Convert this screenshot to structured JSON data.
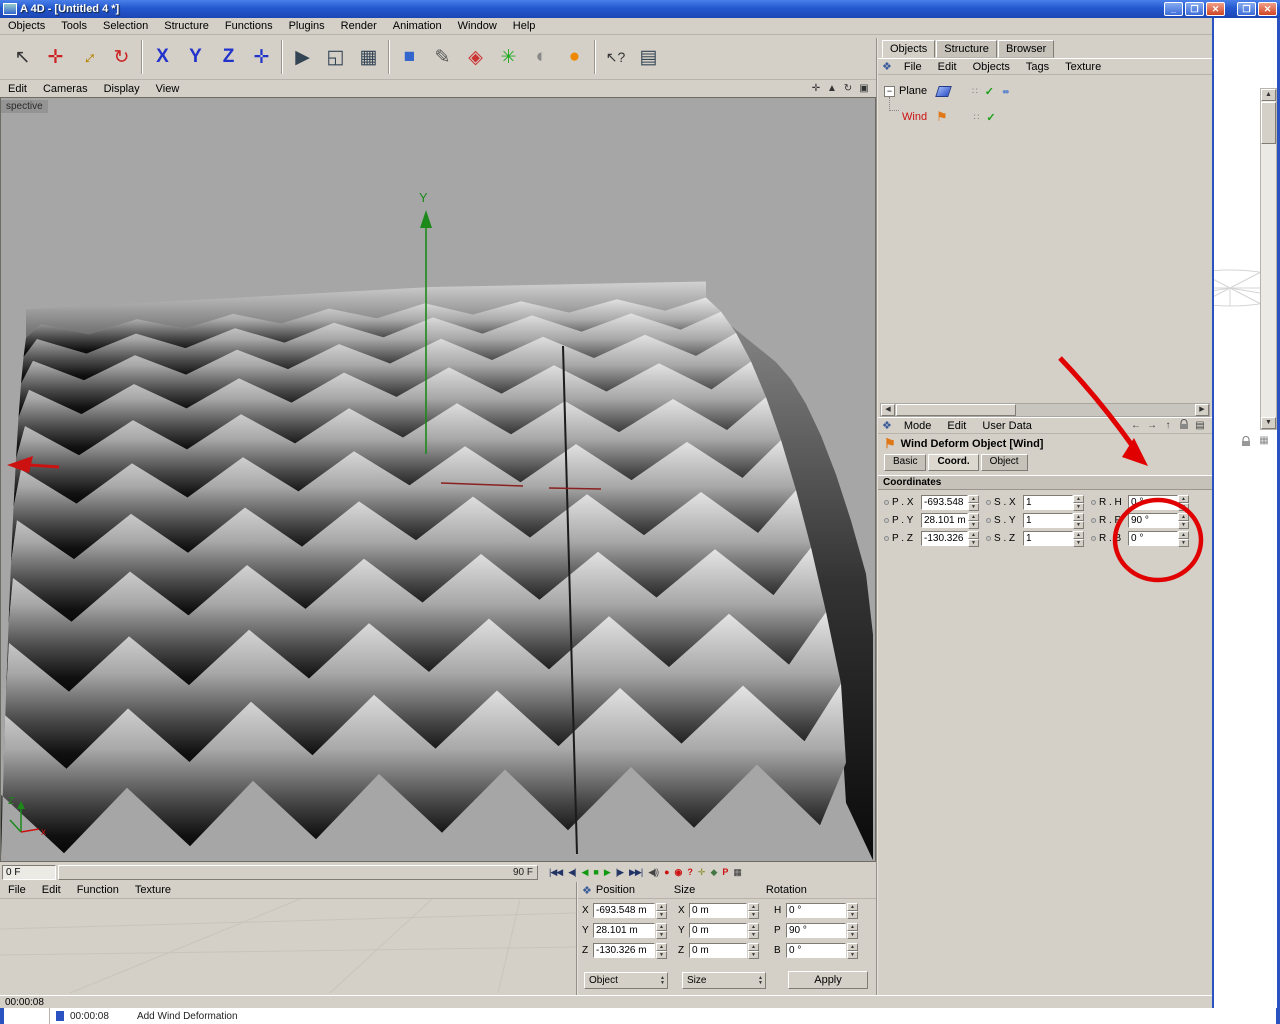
{
  "window": {
    "title": "A 4D - [Untitled 4 *]",
    "status_time": "00:00:08",
    "taskbar_time": "00:00:08",
    "taskbar_action": "Add Wind Deformation",
    "buttons": {
      "minimize": "_",
      "maximize": "❐",
      "close": "✕"
    }
  },
  "colors": {
    "annotation": "#E00000",
    "selected_object": "#CC1111",
    "enabled_check": "#18A018",
    "axis_y": "#1B8A1B",
    "axis_x": "#CC1111",
    "titlebar_blue": "#2458D0"
  },
  "menubar": {
    "items": [
      "Objects",
      "Tools",
      "Selection",
      "Structure",
      "Functions",
      "Plugins",
      "Render",
      "Animation",
      "Window",
      "Help"
    ]
  },
  "toolbar": [
    {
      "name": "cursor-tool",
      "glyph": "↖",
      "color": "#333333"
    },
    {
      "name": "move-tool",
      "glyph": "✛",
      "color": "#CC2222"
    },
    {
      "name": "scale-tool",
      "glyph": "↔",
      "color": "#B8860B"
    },
    {
      "name": "rotate-tool",
      "glyph": "↻",
      "color": "#CC2222"
    },
    {
      "name": "lock-x-axis",
      "glyph": "X",
      "color": "#2233CC"
    },
    {
      "name": "lock-y-axis",
      "glyph": "Y",
      "color": "#2233CC"
    },
    {
      "name": "lock-z-axis",
      "glyph": "Z",
      "color": "#2233CC"
    },
    {
      "name": "coordinate-system",
      "glyph": "✛",
      "color": "#2233CC"
    },
    {
      "name": "render-view",
      "glyph": "▶",
      "color": "#334455"
    },
    {
      "name": "render-region",
      "glyph": "◱",
      "color": "#334455"
    },
    {
      "name": "render-settings",
      "glyph": "▦",
      "color": "#334455"
    },
    {
      "name": "add-primitive",
      "glyph": "■",
      "color": "#3366CC"
    },
    {
      "name": "add-spline",
      "glyph": "✎",
      "color": "#555555"
    },
    {
      "name": "add-deformer",
      "glyph": "◈",
      "color": "#CC3333"
    },
    {
      "name": "add-particles",
      "glyph": "✳",
      "color": "#22AA22"
    },
    {
      "name": "add-light",
      "glyph": "◐",
      "color": "#888888"
    },
    {
      "name": "add-sky",
      "glyph": "●",
      "color": "#EE8800"
    },
    {
      "name": "help-cursor",
      "glyph": "↖?",
      "color": "#333333"
    },
    {
      "name": "structure-table",
      "glyph": "▤",
      "color": "#334455"
    }
  ],
  "viewport": {
    "menu": [
      "Edit",
      "Cameras",
      "Display",
      "View"
    ],
    "view_label": "spective",
    "axis_y_label": "Y",
    "gizmo_z_label": "Z",
    "gizmo_x_label": "x",
    "nav_icons": [
      "✛",
      "▲",
      "↻",
      "▣"
    ],
    "timeline": {
      "current": "0 F",
      "end": "90 F"
    },
    "transport": [
      "|◀◀",
      "◀|",
      "◀",
      "■",
      "▶",
      "|▶",
      "▶▶|"
    ],
    "extra": [
      "◀))",
      "●",
      "◉",
      "?",
      "✛",
      "◆",
      "P",
      "▦"
    ]
  },
  "object_manager": {
    "tabs": [
      "Objects",
      "Structure",
      "Browser"
    ],
    "menu": [
      "File",
      "Edit",
      "Objects",
      "Tags",
      "Texture"
    ],
    "items": [
      {
        "name": "Plane"
      },
      {
        "name": "Wind"
      }
    ]
  },
  "attribute_manager": {
    "menu": [
      "Mode",
      "Edit",
      "User Data"
    ],
    "title": "Wind Deform Object [Wind]",
    "tabs": [
      "Basic",
      "Coord.",
      "Object"
    ],
    "section": "Coordinates",
    "coords": {
      "px_label": "P . X",
      "px": "-693.548 m",
      "py_label": "P . Y",
      "py": "28.101 m",
      "pz_label": "P . Z",
      "pz": "-130.326 m",
      "sx_label": "S . X",
      "sx": "1",
      "sy_label": "S . Y",
      "sy": "1",
      "sz_label": "S . Z",
      "sz": "1",
      "rh_label": "R . H",
      "rh": "0 °",
      "rp_label": "R . P",
      "rp": "90 °",
      "rb_label": "R . B",
      "rb": "0 °"
    }
  },
  "coordinate_manager": {
    "menu": [
      "File",
      "Edit",
      "Function",
      "Texture"
    ],
    "headers": [
      "Position",
      "Size",
      "Rotation"
    ],
    "position": {
      "x_label": "X",
      "x": "-693.548 m",
      "y_label": "Y",
      "y": "28.101 m",
      "z_label": "Z",
      "z": "-130.326 m"
    },
    "size": {
      "x_label": "X",
      "x": "0 m",
      "y_label": "Y",
      "y": "0 m",
      "z_label": "Z",
      "z": "0 m"
    },
    "rotation": {
      "h_label": "H",
      "h": "0 °",
      "p_label": "P",
      "p": "90 °",
      "b_label": "B",
      "b": "0 °"
    },
    "mode_dropdown": "Object",
    "size_dropdown": "Size",
    "apply": "Apply"
  }
}
